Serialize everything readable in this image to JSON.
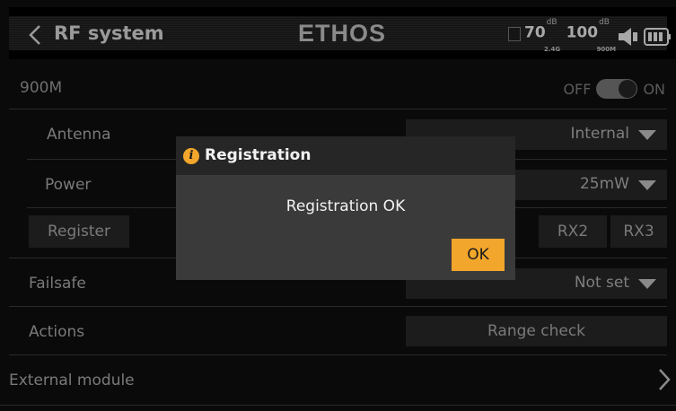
{
  "header": {
    "title": "RF system",
    "logo_text": "ETHOS",
    "rssi_24": "70",
    "rssi_24_unit": "dB",
    "rssi_24_band": "2.4G",
    "rssi_900": "100",
    "rssi_900_unit": "dB",
    "rssi_900_band": "900M",
    "back_icon": "chevron-left-icon",
    "speaker_icon": "speaker-icon",
    "battery_icon": "battery-icon"
  },
  "rows": {
    "module_900": {
      "label": "900M",
      "off_label": "OFF",
      "on_label": "ON",
      "state": "on"
    },
    "antenna": {
      "label": "Antenna",
      "value": "Internal"
    },
    "power": {
      "label": "Power",
      "value": "25mW"
    },
    "register": {
      "label": "Register",
      "rx2": "RX2",
      "rx3": "RX3"
    },
    "failsafe": {
      "label": "Failsafe",
      "value": "Not set"
    },
    "actions": {
      "label": "Actions",
      "value": "Range check"
    },
    "external": {
      "label": "External module"
    }
  },
  "dialog": {
    "icon": "info-icon",
    "title": "Registration",
    "message": "Registration OK",
    "ok_label": "OK"
  },
  "colors": {
    "accent": "#f2a62b",
    "dialog_bg": "#3a3a3a",
    "dialog_header": "#262626",
    "field_bg": "#1c1c1c"
  }
}
